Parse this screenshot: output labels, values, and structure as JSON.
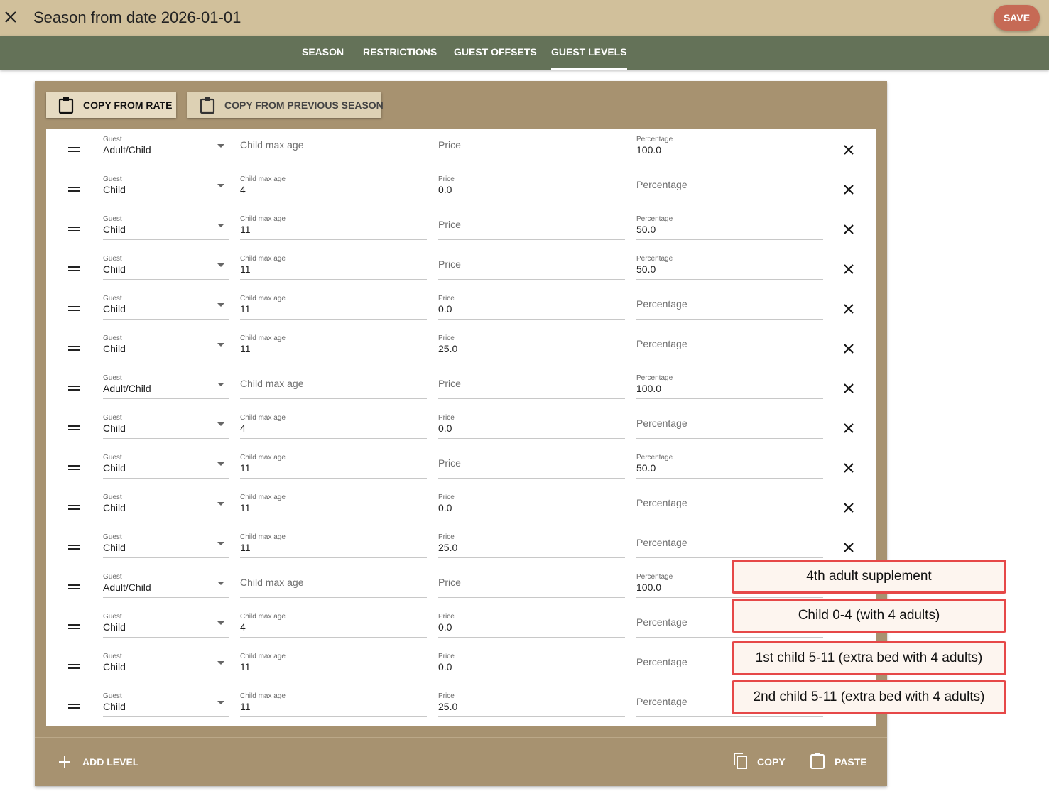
{
  "header": {
    "title": "Season from date 2026-01-01",
    "save_label": "SAVE"
  },
  "tabs": [
    {
      "label": "SEASON",
      "active": false
    },
    {
      "label": "RESTRICTIONS",
      "active": false
    },
    {
      "label": "GUEST OFFSETS",
      "active": false
    },
    {
      "label": "GUEST LEVELS",
      "active": true
    }
  ],
  "toolbar": {
    "copy_from_rate_label": "COPY FROM RATE",
    "copy_from_previous_season_label": "COPY FROM PREVIOUS SEASON"
  },
  "field_labels": {
    "guest": "Guest",
    "child_max_age": "Child max age",
    "price": "Price",
    "percentage": "Percentage"
  },
  "levels": [
    {
      "guest": "Adult/Child",
      "child_max_age": "",
      "price": "",
      "percentage": "100.0"
    },
    {
      "guest": "Child",
      "child_max_age": "4",
      "price": "0.0",
      "percentage": ""
    },
    {
      "guest": "Child",
      "child_max_age": "11",
      "price": "",
      "percentage": "50.0"
    },
    {
      "guest": "Child",
      "child_max_age": "11",
      "price": "",
      "percentage": "50.0"
    },
    {
      "guest": "Child",
      "child_max_age": "11",
      "price": "0.0",
      "percentage": ""
    },
    {
      "guest": "Child",
      "child_max_age": "11",
      "price": "25.0",
      "percentage": ""
    },
    {
      "guest": "Adult/Child",
      "child_max_age": "",
      "price": "",
      "percentage": "100.0"
    },
    {
      "guest": "Child",
      "child_max_age": "4",
      "price": "0.0",
      "percentage": ""
    },
    {
      "guest": "Child",
      "child_max_age": "11",
      "price": "",
      "percentage": "50.0"
    },
    {
      "guest": "Child",
      "child_max_age": "11",
      "price": "0.0",
      "percentage": ""
    },
    {
      "guest": "Child",
      "child_max_age": "11",
      "price": "25.0",
      "percentage": ""
    },
    {
      "guest": "Adult/Child",
      "child_max_age": "",
      "price": "",
      "percentage": "100.0"
    },
    {
      "guest": "Child",
      "child_max_age": "4",
      "price": "0.0",
      "percentage": ""
    },
    {
      "guest": "Child",
      "child_max_age": "11",
      "price": "0.0",
      "percentage": ""
    },
    {
      "guest": "Child",
      "child_max_age": "11",
      "price": "25.0",
      "percentage": ""
    }
  ],
  "footer": {
    "add_level_label": "ADD LEVEL",
    "copy_label": "COPY",
    "paste_label": "PASTE"
  },
  "annotations": [
    "4th adult supplement",
    "Child 0-4 (with 4 adults)",
    "1st child 5-11 (extra bed with 4 adults)",
    "2nd child 5-11 (extra bed with 4 adults)"
  ]
}
